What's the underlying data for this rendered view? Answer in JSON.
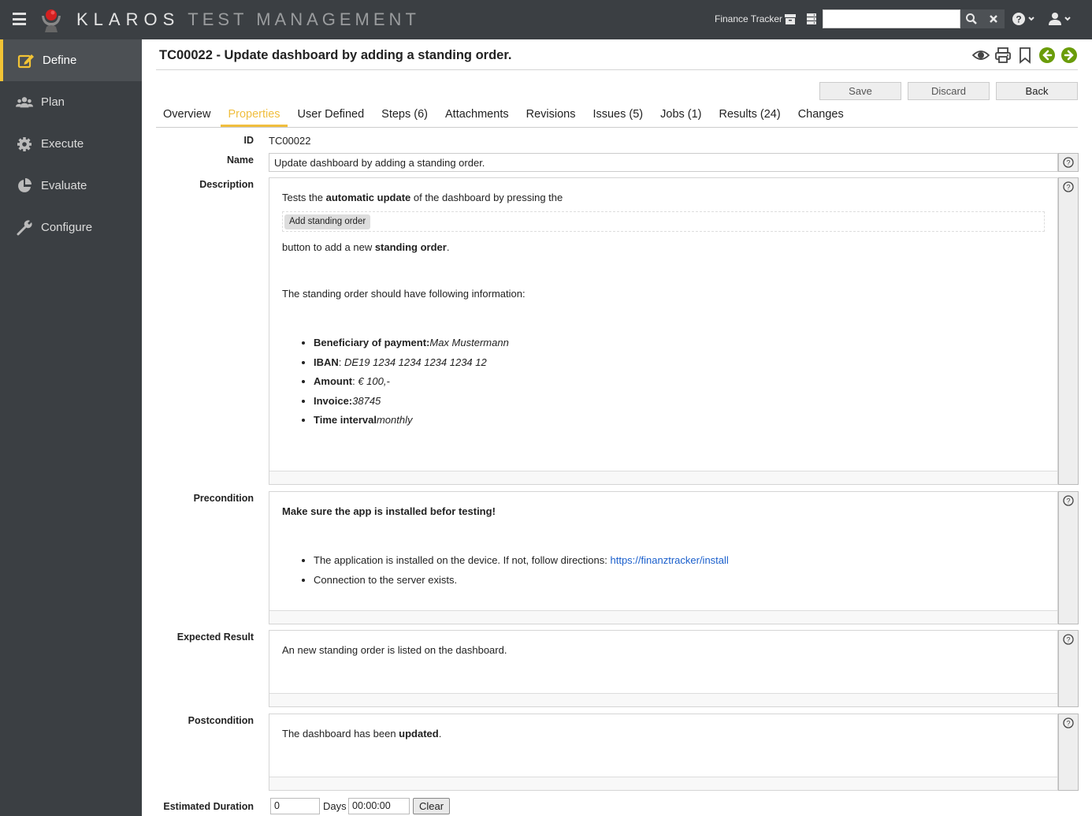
{
  "header": {
    "brand_primary": "KLAROS",
    "brand_secondary": "TEST MANAGEMENT",
    "project_name": "Finance Tracker",
    "search": {
      "value": "",
      "placeholder": ""
    }
  },
  "sidebar": {
    "items": [
      {
        "label": "Define",
        "icon": "edit-icon",
        "active": true
      },
      {
        "label": "Plan",
        "icon": "users-icon",
        "active": false
      },
      {
        "label": "Execute",
        "icon": "gear-icon",
        "active": false
      },
      {
        "label": "Evaluate",
        "icon": "pie-chart-icon",
        "active": false
      },
      {
        "label": "Configure",
        "icon": "wrench-icon",
        "active": false
      }
    ]
  },
  "page": {
    "title": "TC00022 - Update dashboard by adding a standing order.",
    "actions": {
      "save": "Save",
      "discard": "Discard",
      "back": "Back"
    }
  },
  "tabs": [
    {
      "label": "Overview",
      "active": false
    },
    {
      "label": "Properties",
      "active": true
    },
    {
      "label": "User Defined",
      "active": false
    },
    {
      "label": "Steps (6)",
      "active": false
    },
    {
      "label": "Attachments",
      "active": false
    },
    {
      "label": "Revisions",
      "active": false
    },
    {
      "label": "Issues (5)",
      "active": false
    },
    {
      "label": "Jobs (1)",
      "active": false
    },
    {
      "label": "Results (24)",
      "active": false
    },
    {
      "label": "Changes",
      "active": false
    }
  ],
  "form": {
    "id_label": "ID",
    "id_value": "TC00022",
    "name_label": "Name",
    "name_value": "Update dashboard by adding a standing order.",
    "description_label": "Description",
    "description": {
      "intro_pre": "Tests the ",
      "intro_bold": "automatic update",
      "intro_post": " of the dashboard by pressing the",
      "inline_button": "Add standing order",
      "line2_pre": "button to add a new ",
      "line2_bold": "standing order",
      "line2_post": ".",
      "line3": "The standing order should have following information:",
      "items": [
        {
          "key": "Beneficiary of payment:",
          "value": "Max Mustermann"
        },
        {
          "key": "IBAN",
          "sep": ": ",
          "value": "DE19 1234 1234 1234 1234 12"
        },
        {
          "key": "Amount",
          "sep": ": ",
          "value": "€ 100,-"
        },
        {
          "key": "Invoice:",
          "value": "38745"
        },
        {
          "key": "Time interval",
          "value": "monthly"
        }
      ]
    },
    "precondition_label": "Precondition",
    "precondition": {
      "heading": "Make sure the app is installed befor testing!",
      "item1_text": "The application is installed on the device. If not, follow directions: ",
      "item1_link": "https://finanztracker/install",
      "item2_text": "Connection to the server exists."
    },
    "expected_label": "Expected Result",
    "expected_text": "An new standing order is listed on the dashboard.",
    "postcondition_label": "Postcondition",
    "postcondition": {
      "pre": "The dashboard has been ",
      "bold": "updated",
      "post": "."
    },
    "duration_label": "Estimated Duration",
    "duration_days": "0",
    "days_label": "Days",
    "duration_time": "00:00:00",
    "clear_label": "Clear"
  }
}
